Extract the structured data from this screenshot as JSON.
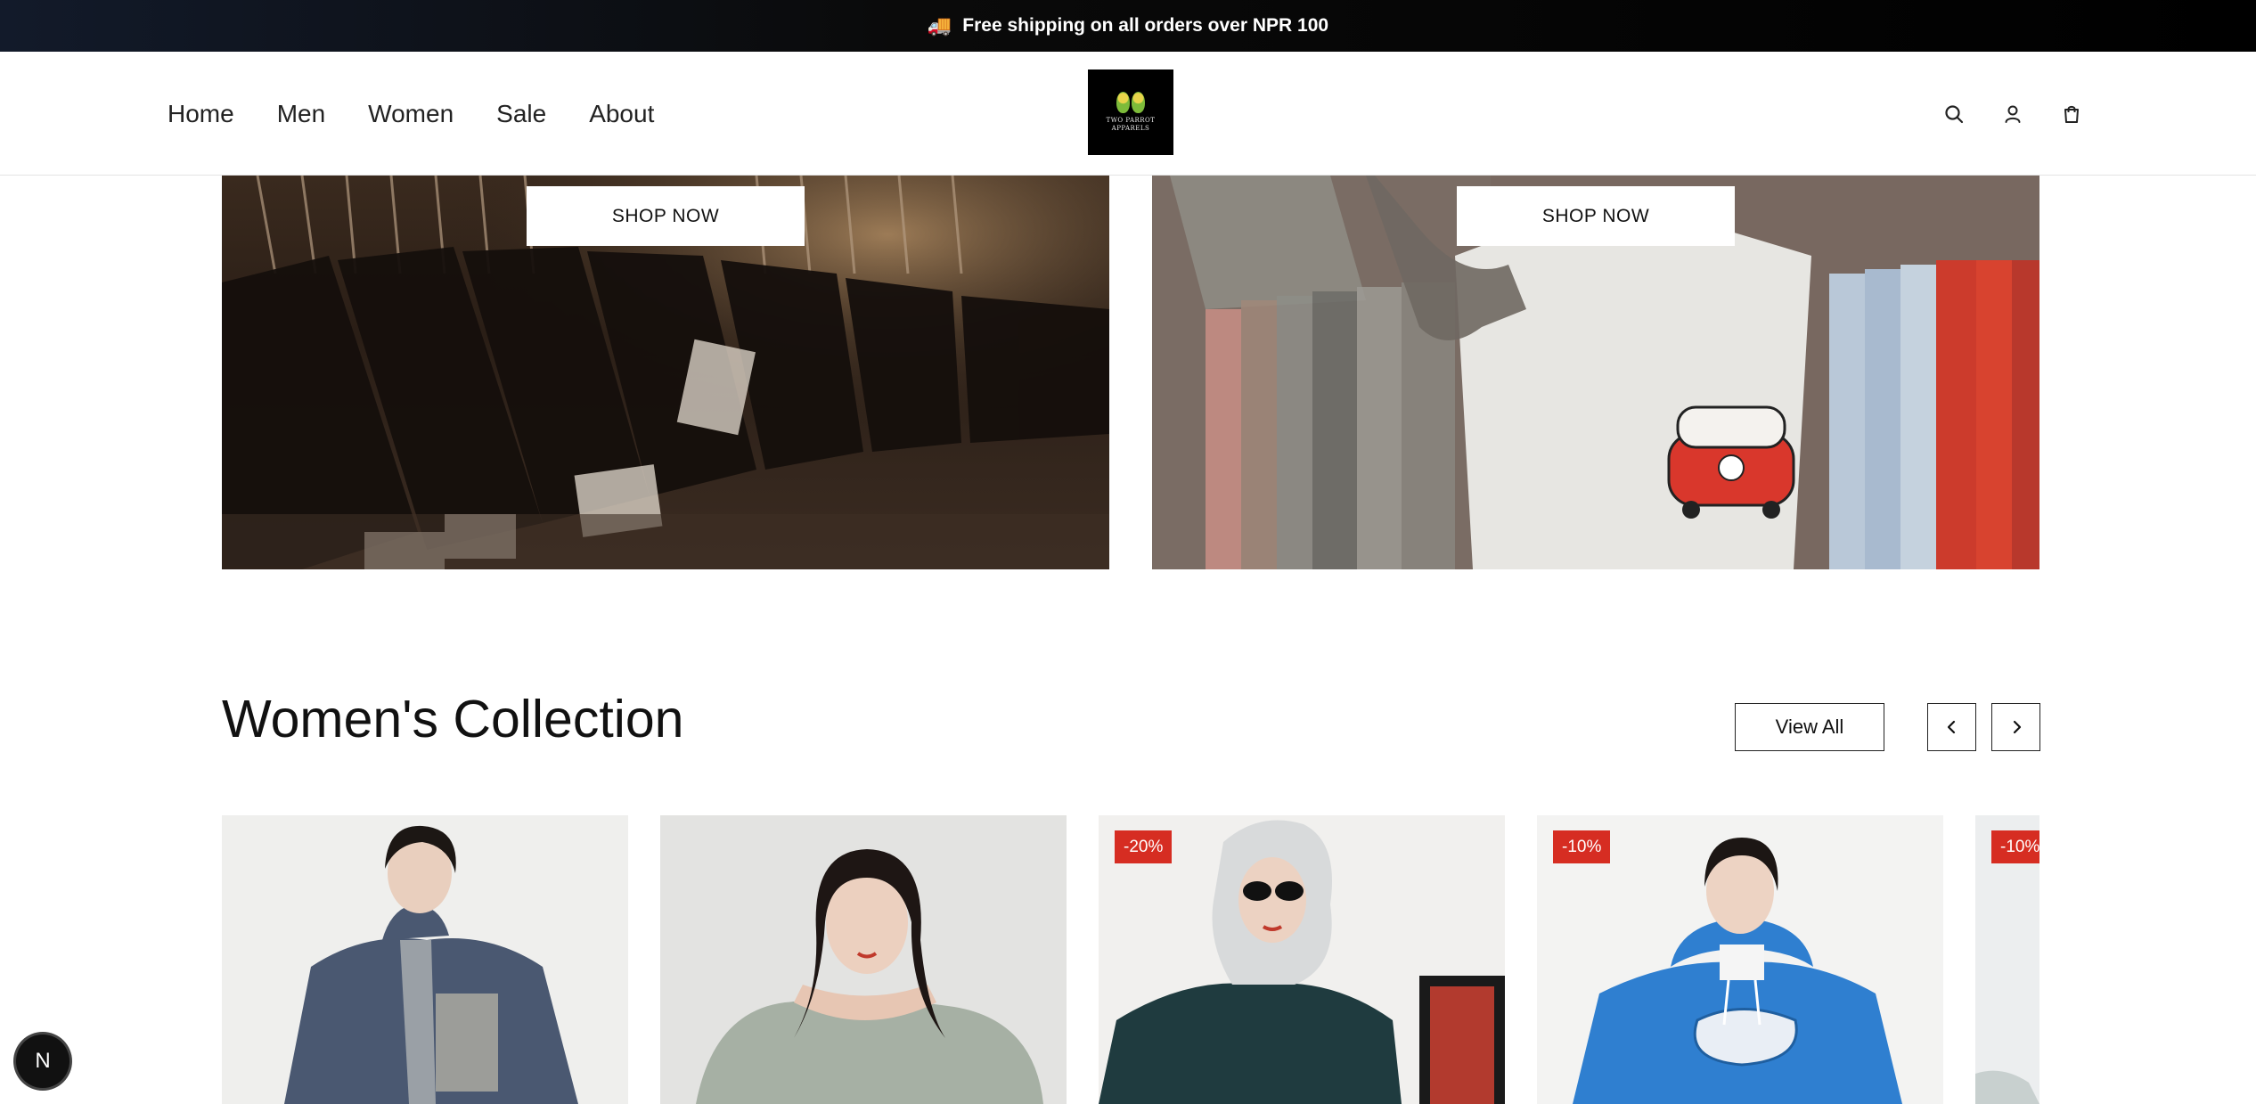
{
  "announcement": {
    "icon": "truck-icon",
    "text": "Free shipping on all orders over NPR 100"
  },
  "nav": {
    "items": [
      "Home",
      "Men",
      "Women",
      "Sale",
      "About"
    ]
  },
  "logo": {
    "text": "TWO PARROT APPARELS"
  },
  "header_icons": [
    "search-icon",
    "user-icon",
    "cart-icon"
  ],
  "banners": [
    {
      "button": "SHOP NOW"
    },
    {
      "button": "SHOP NOW"
    }
  ],
  "collection": {
    "title": "Women's Collection",
    "view_all": "View All",
    "products": [
      {
        "badge": ""
      },
      {
        "badge": ""
      },
      {
        "badge": "-20%"
      },
      {
        "badge": "-10%"
      },
      {
        "badge": "-10%"
      }
    ]
  },
  "dev_badge": {
    "text": "N"
  },
  "colors": {
    "announcement_bg": "#000000",
    "badge_bg": "#d62d22",
    "text": "#111111"
  }
}
